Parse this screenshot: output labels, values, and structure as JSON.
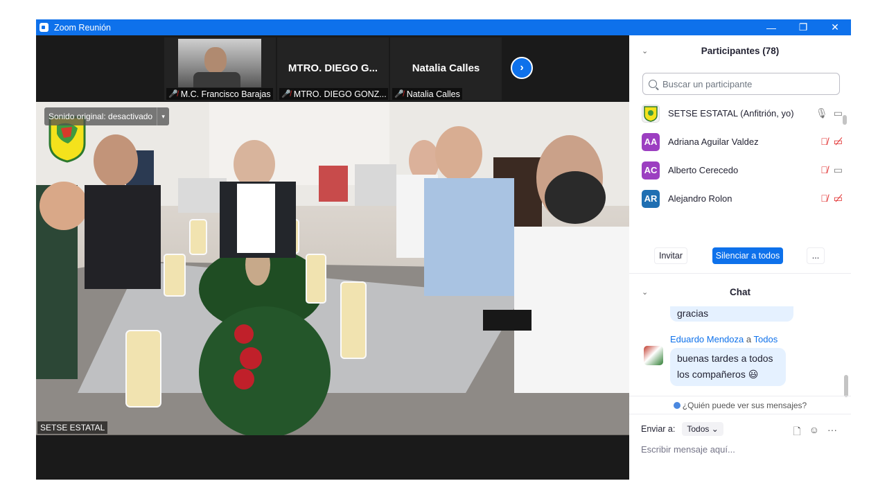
{
  "window": {
    "title": "Zoom Reunión",
    "controls": [
      "—",
      "❐",
      "✕"
    ]
  },
  "strip": {
    "thumbs": [
      {
        "big_name": "",
        "label": "M.C. Francisco Barajas"
      },
      {
        "big_name": "MTRO. DIEGO G...",
        "label": "MTRO. DIEGO GONZ..."
      },
      {
        "big_name": "Natalia Calles",
        "label": "Natalia Calles"
      }
    ],
    "next_glyph": "›"
  },
  "main_video": {
    "sound_label": "Sonido original: desactivado",
    "dropdown_glyph": "▾",
    "speaker_label": "SETSE ESTATAL"
  },
  "participants": {
    "title": "Participantes (78)",
    "search_placeholder": "Buscar un participante",
    "list": [
      {
        "initials": "",
        "name": "SETSE ESTATAL (Anfitrión, yo)",
        "avatar_color": "#f2f2f2",
        "muted": false,
        "video_off": false
      },
      {
        "initials": "AA",
        "name": "Adriana Aguilar Valdez",
        "avatar_color": "#9c3fc1",
        "muted": true,
        "video_off": true
      },
      {
        "initials": "AC",
        "name": "Alberto Cerecedo",
        "avatar_color": "#9c3fc1",
        "muted": true,
        "video_off": false
      },
      {
        "initials": "AR",
        "name": "Alejandro Rolon",
        "avatar_color": "#1f6fb2",
        "muted": true,
        "video_off": true
      }
    ],
    "invite_label": "Invitar",
    "mute_all_label": "Silenciar a todos",
    "more_label": "..."
  },
  "chat": {
    "title": "Chat",
    "prev_message": "gracias",
    "sender": "Eduardo Mendoza",
    "to_word": "a",
    "recipient": "Todos",
    "message_line1": "buenas tardes a todos",
    "message_line2": "los compañeros",
    "emoji": "😃",
    "who_can_see": "¿Quién puede ver sus mensajes?",
    "send_to_label": "Enviar a:",
    "send_to_value": "Todos",
    "input_placeholder": "Escribir mensaje aquí..."
  },
  "colors": {
    "accent": "#0e71eb",
    "muted_red": "#e02828"
  }
}
